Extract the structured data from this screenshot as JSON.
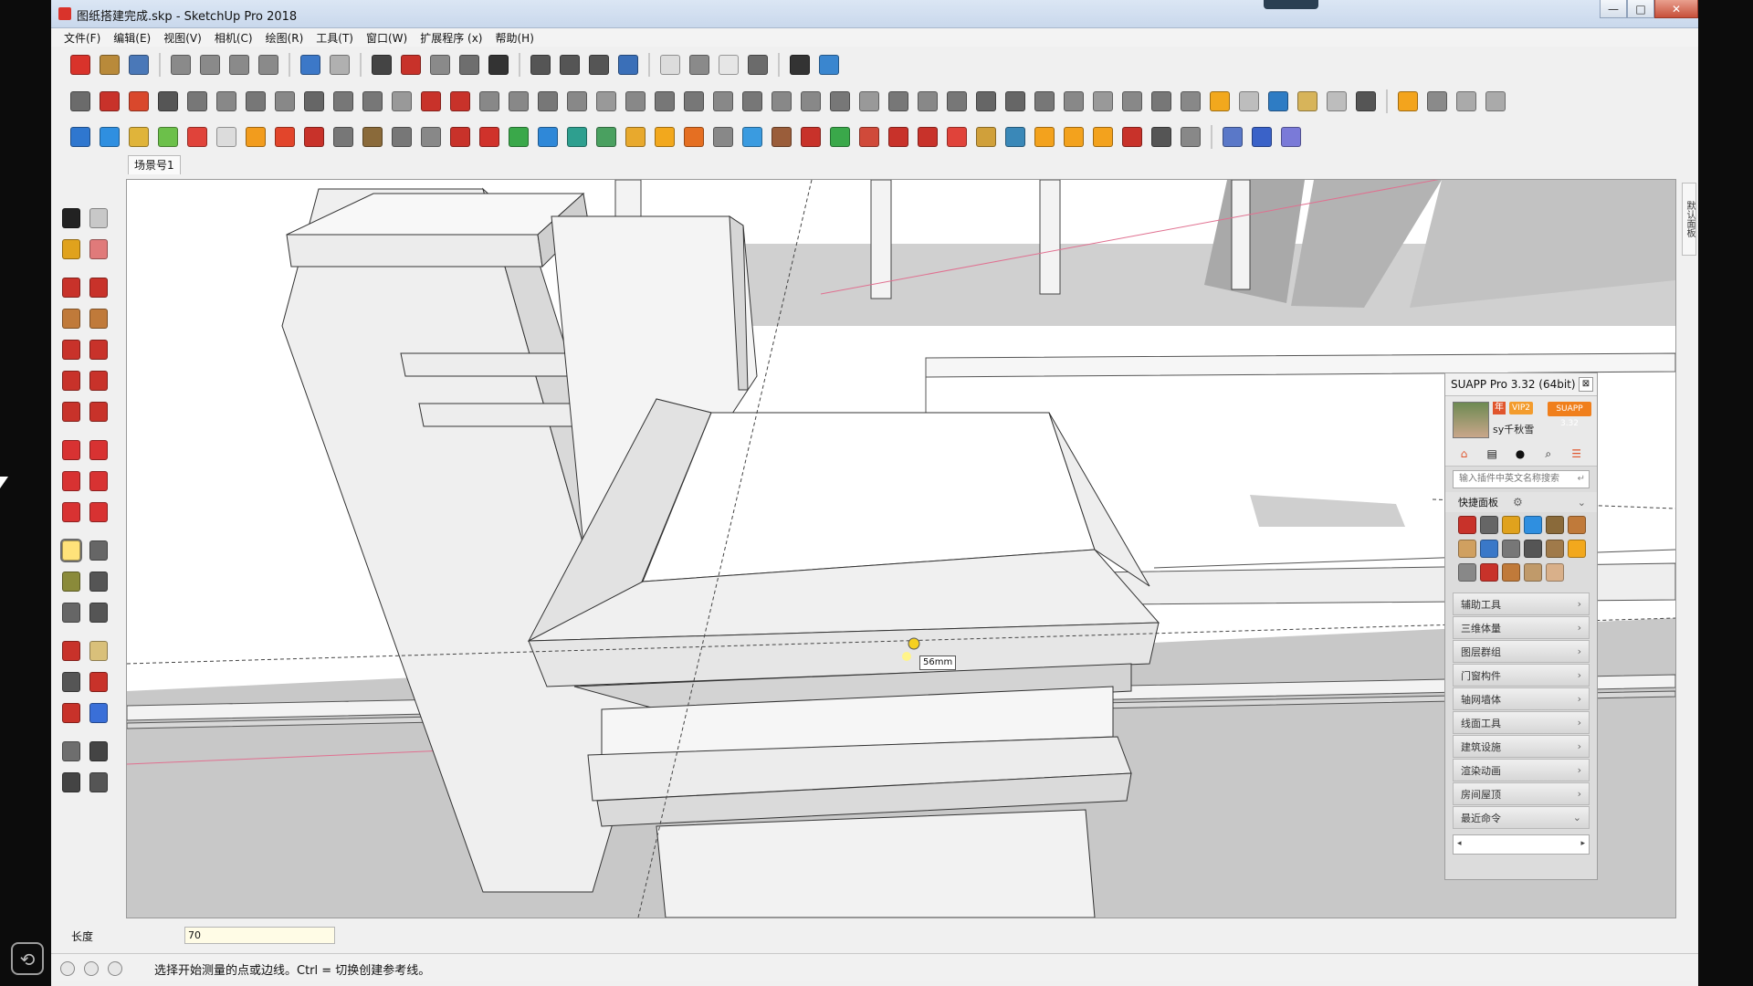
{
  "window": {
    "title": "图纸搭建完成.skp - SketchUp Pro 2018",
    "minimize": "—",
    "maximize": "□",
    "close": "✕"
  },
  "menu": [
    "文件(F)",
    "编辑(E)",
    "视图(V)",
    "相机(C)",
    "绘图(R)",
    "工具(T)",
    "窗口(W)",
    "扩展程序 (x)",
    "帮助(H)"
  ],
  "toolbar_colors": {
    "row1": [
      "#d9332b",
      "#b98a3a",
      "#4a78b8",
      "#8a8a8a",
      "#8a8a8a",
      "#8a8a8a",
      "#8a8a8a",
      "#3c78c8",
      "#b0b0b0",
      "#444444",
      "#c8322a",
      "#8a8a8a",
      "#6e6e6e",
      "#333333",
      "#555555",
      "#555555",
      "#555555",
      "#3a6fb8",
      "#dcdcdc",
      "#8a8a8a",
      "#e6e6e6",
      "#6b6b6b",
      "#333333",
      "#3a86cf"
    ],
    "row2": [
      "#6b6b6b",
      "#c8322a",
      "#d9482c",
      "#555555",
      "#777777",
      "#888888",
      "#777777",
      "#888888",
      "#666666",
      "#777777",
      "#777777",
      "#999999",
      "#c8322a",
      "#c8322a",
      "#888888",
      "#888888",
      "#777777",
      "#888888",
      "#999999",
      "#888888",
      "#777777",
      "#777777",
      "#888888",
      "#777777",
      "#888888",
      "#888888",
      "#777777",
      "#999999",
      "#777777",
      "#888888",
      "#777777",
      "#666666",
      "#666666",
      "#777777",
      "#888888",
      "#999999",
      "#888888",
      "#777777",
      "#888888",
      "#f2a81d",
      "#bdbdbd",
      "#2e7cc4",
      "#d7b45a",
      "#bdbdbd",
      "#555555",
      "#f3a41d",
      "#8a8a8a",
      "#aaaaaa",
      "#aaaaaa"
    ],
    "row3": [
      "#2f77cf",
      "#2f8fe0",
      "#e0b43a",
      "#6cc04a",
      "#e0433a",
      "#dcdcdc",
      "#f29c1d",
      "#e2452b",
      "#c8322a",
      "#777777",
      "#8a6a3a",
      "#777777",
      "#888888",
      "#c8322a",
      "#d0322b",
      "#3aa84a",
      "#2f88d8",
      "#2e9f8f",
      "#4aa060",
      "#e8a92d",
      "#f2a81d",
      "#e56f22",
      "#888888",
      "#3a9be0",
      "#9a5d3a",
      "#c8322a",
      "#3aa84a",
      "#d04a3a",
      "#c8322a",
      "#c8322a",
      "#e0433a",
      "#d0a03a",
      "#3a88b8",
      "#f3a21d",
      "#f3a21d",
      "#f3a21d",
      "#c8322a",
      "#555555",
      "#888888",
      "#5a78c8",
      "#3a62c8",
      "#7a7ad8"
    ]
  },
  "left_tool_colors": [
    [
      "#222222",
      "#c8c8c8"
    ],
    [
      "#e0a21d",
      "#e07a7a"
    ],
    [
      "#c8322a",
      "#c8322a"
    ],
    [
      "#c07a3a",
      "#c07a3a"
    ],
    [
      "#c8322a",
      "#c8322a"
    ],
    [
      "#c8322a",
      "#c8322a"
    ],
    [
      "#c8322a",
      "#c8322a"
    ],
    [
      "#d83232",
      "#d83232"
    ],
    [
      "#d83232",
      "#d83232"
    ],
    [
      "#d83232",
      "#d83232"
    ],
    [
      "#e0b43a",
      "#666666"
    ],
    [
      "#8a8a3a",
      "#555555"
    ],
    [
      "#666666",
      "#555555"
    ],
    [
      "#c8322a",
      "#d9c07a"
    ],
    [
      "#555555",
      "#c8322a"
    ],
    [
      "#c8322a",
      "#3a6fd8"
    ],
    [
      "#6e6e6e",
      "#444444"
    ],
    [
      "#444444",
      "#555555"
    ]
  ],
  "scene_tab": "场景号1",
  "tray_tab": "默认面板",
  "viewport": {
    "tooltip": "56mm"
  },
  "suapp": {
    "title": "SUAPP Pro 3.32 (64bit)",
    "year_badge": "年",
    "vip_badge": "VIP2",
    "version_badge": "SUAPP 3.32",
    "username": "sy千秋雪",
    "tabs": [
      "⌂",
      "▤",
      "●",
      "⌕",
      "☰"
    ],
    "search_placeholder": "输入插件中英文名称搜索",
    "quick_panel": "快捷面板",
    "quick_icon_colors": [
      "#c8322a",
      "#666666",
      "#e0a21d",
      "#2f8fe0",
      "#8a6a3a",
      "#c07a3a",
      "#d0a060",
      "#3a78c8",
      "#777777",
      "#555555",
      "#a07a4a",
      "#f2a81d",
      "#888888",
      "#c8322a",
      "#c07a3a",
      "#c09a6a",
      "#d9b08a"
    ],
    "categories": [
      "辅助工具",
      "三维体量",
      "图层群组",
      "门窗构件",
      "轴网墙体",
      "线面工具",
      "建筑设施",
      "渲染动画",
      "房间屋顶",
      "最近命令"
    ],
    "category_arrows": [
      "›",
      "›",
      "›",
      "›",
      "›",
      "›",
      "›",
      "›",
      "›",
      "⌄"
    ],
    "scroll_left": "◂",
    "scroll_right": "▸"
  },
  "measurements": {
    "label": "长度",
    "value": "70"
  },
  "status": {
    "text": "选择开始测量的点或边线。Ctrl = 切换创建参考线。"
  }
}
